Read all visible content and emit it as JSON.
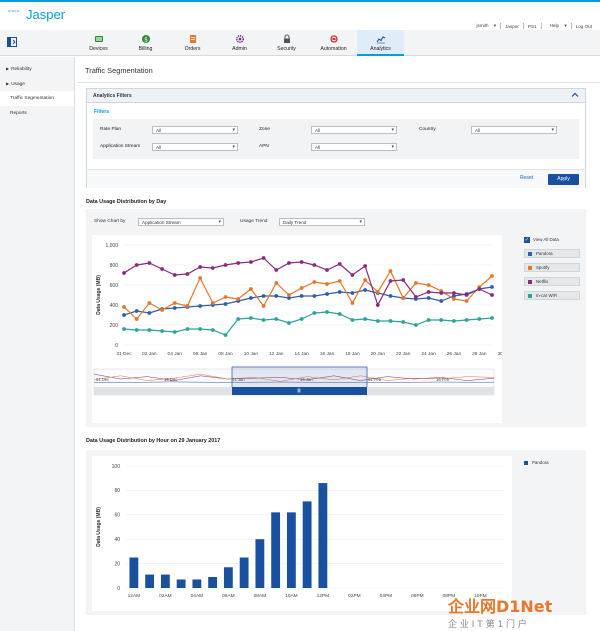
{
  "app": {
    "cisco": "cisco",
    "brand": "Jasper"
  },
  "user_nav": {
    "user": "jsmith",
    "account": "Jasper",
    "id": "PS1",
    "help": "Help",
    "logout": "Log Out"
  },
  "tabs": [
    {
      "label": "Devices",
      "icon": "devices-icon"
    },
    {
      "label": "Billing",
      "icon": "billing-icon"
    },
    {
      "label": "Orders",
      "icon": "orders-icon"
    },
    {
      "label": "Admin",
      "icon": "admin-icon"
    },
    {
      "label": "Security",
      "icon": "security-icon"
    },
    {
      "label": "Automation",
      "icon": "automation-icon"
    },
    {
      "label": "Analytics",
      "icon": "analytics-icon",
      "active": true
    }
  ],
  "sidebar": {
    "items": [
      {
        "label": "Reliability",
        "expandable": true
      },
      {
        "label": "Usage",
        "expandable": true
      },
      {
        "label": "Traffic Segmentation",
        "active": true
      },
      {
        "label": "Reports"
      }
    ]
  },
  "page_title": "Traffic Segmentation",
  "filters": {
    "header": "Analytics Filters",
    "subheader": "Filters",
    "rate_plan": {
      "label": "Rate Plan",
      "value": "All"
    },
    "zone": {
      "label": "Zone",
      "value": "All"
    },
    "country": {
      "label": "Country",
      "value": "All"
    },
    "application_stream": {
      "label": "Application Stream",
      "value": "All"
    },
    "apn": {
      "label": "APN",
      "value": "All"
    },
    "reset": "Reset",
    "apply": "Apply"
  },
  "day_section": {
    "title": "Data Usage Distribution by Day",
    "show_chart_by_label": "Show Chart by",
    "show_chart_by_value": "Application Stream",
    "usage_trend_label": "Usage Trend",
    "usage_trend_value": "Daily Trend",
    "view_all": "View All Data"
  },
  "hour_section": {
    "title": "Data Usage Distribution by Hour on 29 January 2017"
  },
  "colors": {
    "pandora": "#2f5fa8",
    "spotify": "#e8762c",
    "netflix": "#8c2a7e",
    "incar": "#2da39a",
    "bar": "#1a50a0"
  },
  "chart_data": [
    {
      "type": "line",
      "ylabel": "Data Usage (MB)",
      "ylim": [
        0,
        1000
      ],
      "yticks": [
        "0",
        "200",
        "400",
        "600",
        "800",
        "1,000"
      ],
      "xtick_labels": [
        "31 Dec",
        "02 Jan",
        "04 Jan",
        "06 Jan",
        "08 Jan",
        "10 Jan",
        "12 Jan",
        "14 Jan",
        "16 Jan",
        "18 Jan",
        "20 Jan",
        "22 Jan",
        "24 Jan",
        "26 Jan",
        "28 Jan",
        "30 Jan"
      ],
      "x": [
        30,
        31,
        32,
        33,
        34,
        35,
        36,
        37,
        38,
        39,
        40,
        41,
        42,
        43,
        44,
        45,
        46,
        47,
        48,
        49,
        50,
        51,
        52,
        53,
        54,
        55,
        56,
        57,
        58,
        59
      ],
      "legend_placement": "right",
      "series": [
        {
          "name": "Pandora",
          "color": "#2f5fa8",
          "values": [
            300,
            340,
            320,
            360,
            370,
            380,
            390,
            400,
            410,
            440,
            470,
            490,
            490,
            470,
            490,
            490,
            510,
            530,
            520,
            550,
            520,
            490,
            470,
            460,
            470,
            440,
            490,
            510,
            560,
            580
          ]
        },
        {
          "name": "Spotify",
          "color": "#e8762c",
          "values": [
            380,
            260,
            420,
            350,
            420,
            390,
            670,
            420,
            480,
            460,
            560,
            390,
            620,
            500,
            570,
            630,
            610,
            640,
            420,
            650,
            530,
            740,
            470,
            620,
            600,
            540,
            460,
            440,
            580,
            690
          ]
        },
        {
          "name": "Netflix",
          "color": "#8c2a7e",
          "values": [
            720,
            800,
            820,
            760,
            700,
            710,
            780,
            770,
            800,
            820,
            830,
            870,
            750,
            820,
            830,
            800,
            750,
            810,
            700,
            790,
            400,
            640,
            650,
            480,
            530,
            520,
            520,
            500,
            560,
            500
          ]
        },
        {
          "name": "In-car WiFi",
          "color": "#2da39a",
          "values": [
            160,
            150,
            150,
            140,
            130,
            160,
            160,
            150,
            100,
            260,
            270,
            250,
            260,
            220,
            260,
            320,
            330,
            310,
            250,
            260,
            240,
            240,
            230,
            200,
            250,
            250,
            240,
            250,
            260,
            270
          ]
        }
      ],
      "navigator_labels": [
        "01 Dec",
        "16 Dec",
        "01 Jan",
        "16 Jan",
        "01 Feb",
        "16 Feb"
      ]
    },
    {
      "type": "bar",
      "ylabel": "Data Usage (MB)",
      "ylim": [
        0,
        100
      ],
      "yticks": [
        "0",
        "20",
        "40",
        "60",
        "80",
        "100"
      ],
      "categories": [
        "12AM",
        "1AM",
        "2AM",
        "3AM",
        "4AM",
        "5AM",
        "6AM",
        "7AM",
        "8AM",
        "9AM",
        "10AM",
        "11AM",
        "12PM",
        "1PM",
        "2PM",
        "3PM",
        "4PM",
        "5PM",
        "6PM",
        "7PM",
        "8PM",
        "9PM",
        "10PM",
        "11PM"
      ],
      "xtick_labels": [
        "12AM",
        "02AM",
        "04AM",
        "06AM",
        "08AM",
        "10AM",
        "12PM",
        "02PM",
        "04PM",
        "06PM",
        "08PM",
        "10PM"
      ],
      "series": [
        {
          "name": "Pandora",
          "color": "#1a50a0",
          "values": [
            25,
            11,
            11,
            7,
            7,
            9,
            17,
            25,
            40,
            62,
            62,
            71,
            86,
            0,
            0,
            0,
            0,
            0,
            0,
            0,
            0,
            0,
            0,
            0
          ]
        }
      ]
    }
  ],
  "watermark": {
    "main": "企业网D1Net",
    "sub": "企 业 I T 第 1 门 户"
  }
}
